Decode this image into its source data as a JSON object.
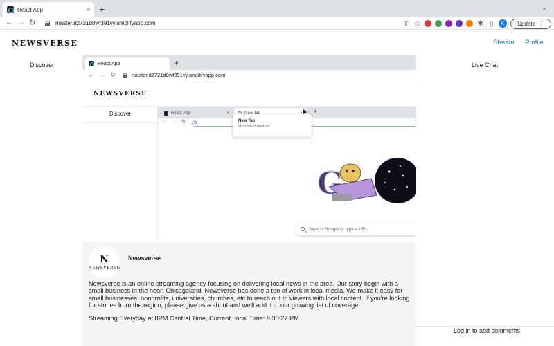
{
  "browser": {
    "tab_title": "React App",
    "tab_close": "×",
    "new_tab": "+",
    "url": "master.d2721d8wf391vy.amplifyapp.com",
    "update_label": "Update",
    "profile_initial": "K",
    "icons": {
      "back": "←",
      "forward": "→",
      "reload": "↻",
      "share": "⇪",
      "star": "☆",
      "extensions": "✱",
      "sidebar": "▯",
      "menu": "⋮",
      "window_chevron": "⌄"
    },
    "extension_colors": [
      "#e53935",
      "#43a047",
      "#8e24aa",
      "#5e35b1",
      "#f57c00"
    ]
  },
  "header": {
    "logo": "NEWSVERSE",
    "nav": [
      "Stream",
      "Profile"
    ]
  },
  "sidebar": {
    "discover_label": "Discover"
  },
  "chat": {
    "title": "Live Chat",
    "login_prompt": "Log in to add comments"
  },
  "stream_preview": {
    "tab_title": "React App",
    "new_tab": "+",
    "url": "master.d2721d8wf391vy.amplifyapp.com",
    "logo": "NEWSVERSE",
    "discover_label": "Discover",
    "inner_browser": {
      "tabs": [
        "React App",
        "New Tab"
      ],
      "close": "×",
      "new_tab": "+",
      "omnibox_glyph": "G",
      "dropdown_title": "New Tab",
      "dropdown_url": "chrome://newtab",
      "search_placeholder": "Search Google or type a URL"
    }
  },
  "channel": {
    "logo_letter": "N",
    "logo_word": "NEWSVERSE",
    "name": "Newsverse",
    "description": "Newsverse is an online streaming agency focusing on delivering local news in the area. Our story begin with a small business in the heart Chicagoland. Newsverse has done a ton of work in local media. We make it easy for small businesses, nonprofits, universities, churches, etc to reach out to viewers with local content. If you're looking for stories from the region, please give us a shout and we'll add it to our growing list of coverage.",
    "schedule": "Streaming Everyday at 8PM Central Time, Current Local Time: 9:30:27 PM"
  }
}
